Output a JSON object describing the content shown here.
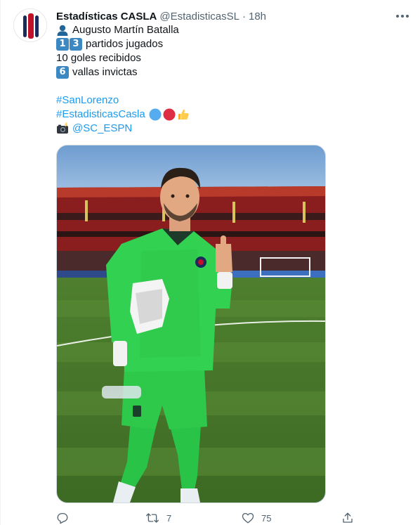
{
  "author": {
    "name": "Estadísticas CASLA",
    "handle": "@EstadisticasSL",
    "separator": "·",
    "time": "18h"
  },
  "tweet": {
    "line1_text": "Augusto Martín Batalla",
    "line2_digits": [
      "1",
      "3"
    ],
    "line2_text": "partidos jugados",
    "line3_text": "10 goles recibidos",
    "line4_digit": "6",
    "line4_text": "vallas invictas",
    "hashtag1": "#SanLorenzo",
    "hashtag2": "#EstadisticasCasla",
    "credit_handle": "@SC_ESPN"
  },
  "icons": {
    "line1": "person-silhouette-icon",
    "hashtag2_emojis": [
      "blue-circle-icon",
      "red-circle-icon",
      "thumbs-up-icon"
    ],
    "credit": "camera-flash-icon",
    "more": "more-options-icon",
    "reply": "reply-icon",
    "retweet": "retweet-icon",
    "like": "like-icon",
    "share": "share-icon"
  },
  "actions": {
    "retweet_count": "7",
    "like_count": "75"
  },
  "colors": {
    "link": "#1d9bf0",
    "text": "#0f1419",
    "secondary": "#536471",
    "keycap": "#3b88c3",
    "jersey": "#2ecc4a"
  }
}
